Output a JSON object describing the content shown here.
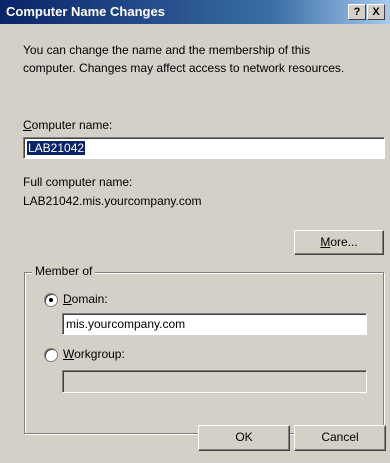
{
  "window": {
    "title": "Computer Name Changes",
    "help_button": "?",
    "close_button": "X"
  },
  "intro": {
    "line1": "You can change the name and the membership of this",
    "line2": "computer. Changes may affect access to network resources."
  },
  "computer_name": {
    "label_accel": "C",
    "label_rest": "omputer name:",
    "value": "LAB21042"
  },
  "full_name": {
    "label": "Full computer name:",
    "value": "LAB21042.mis.yourcompany.com"
  },
  "more_button": {
    "accel": "M",
    "rest": "ore..."
  },
  "member_of": {
    "legend": "Member of",
    "domain_accel": "D",
    "domain_rest": "omain:",
    "domain_selected": true,
    "domain_value": "mis.yourcompany.com",
    "workgroup_accel": "W",
    "workgroup_rest": "orkgroup:",
    "workgroup_value": ""
  },
  "buttons": {
    "ok": "OK",
    "cancel": "Cancel"
  }
}
